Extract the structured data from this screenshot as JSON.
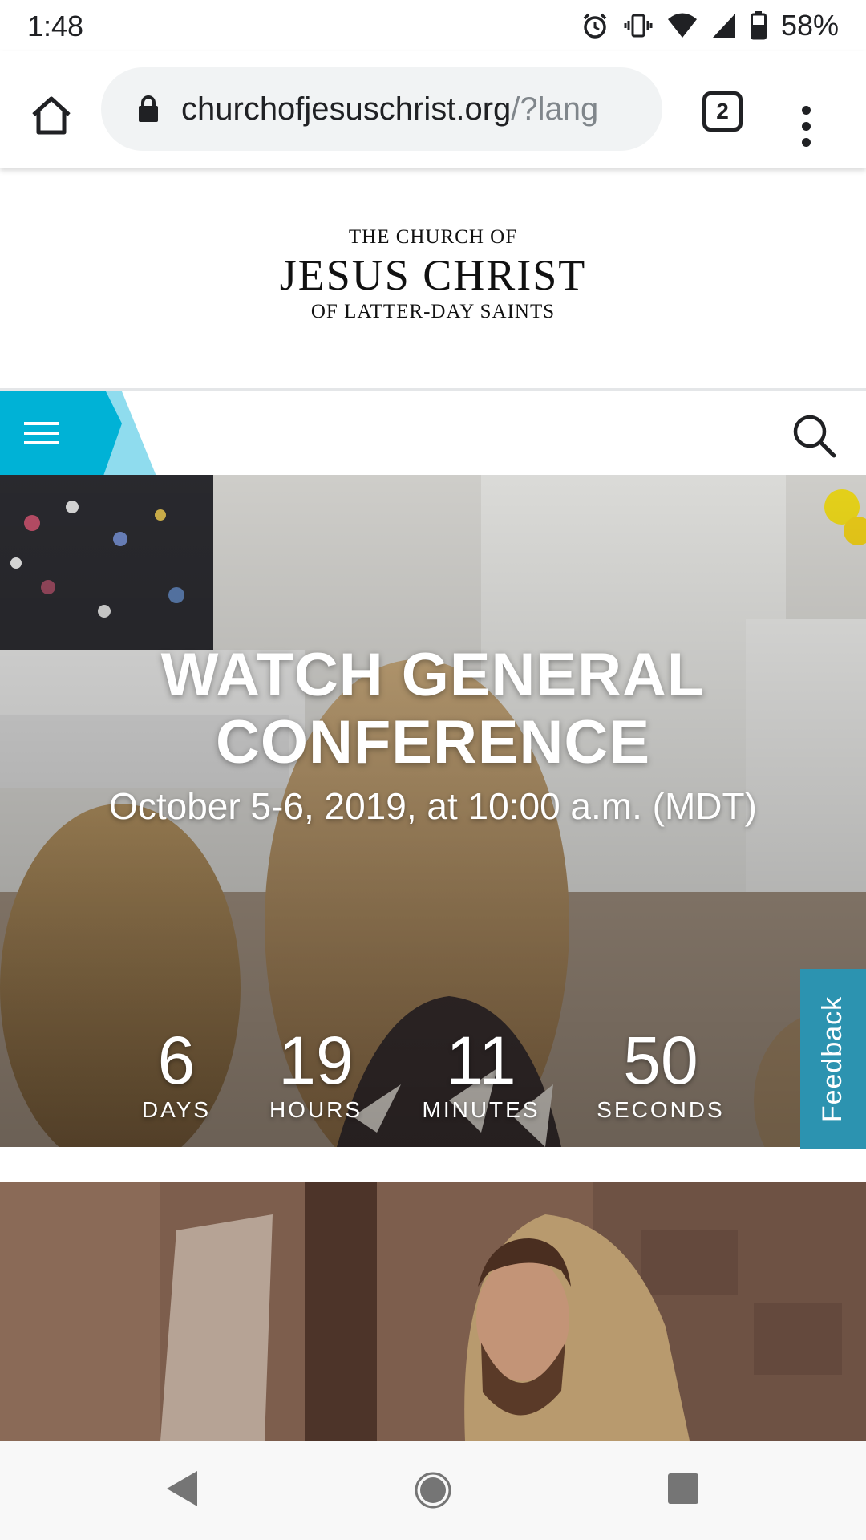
{
  "status_bar": {
    "time": "1:48",
    "battery": "58%",
    "icons": [
      "alarm-icon",
      "vibrate-icon",
      "wifi-icon",
      "cell-signal-icon",
      "battery-icon"
    ]
  },
  "browser": {
    "url_main": "churchofjesuschrist.org",
    "url_rest": "/?lang",
    "tab_count": "2"
  },
  "logo": {
    "line1": "THE CHURCH OF",
    "line2": "JESUS CHRIST",
    "line3": "OF LATTER-DAY SAINTS"
  },
  "hero": {
    "title_line1": "WATCH GENERAL",
    "title_line2": "CONFERENCE",
    "subtitle": "October 5-6, 2019, at 10:00 a.m. (MDT)",
    "countdown": {
      "days": {
        "value": "6",
        "label": "DAYS"
      },
      "hours": {
        "value": "19",
        "label": "HOURS"
      },
      "minutes": {
        "value": "11",
        "label": "MINUTES"
      },
      "seconds": {
        "value": "50",
        "label": "SECONDS"
      }
    }
  },
  "feedback_label": "Feedback",
  "colors": {
    "accent": "#00b2d6",
    "feedback": "#2c93b0"
  }
}
